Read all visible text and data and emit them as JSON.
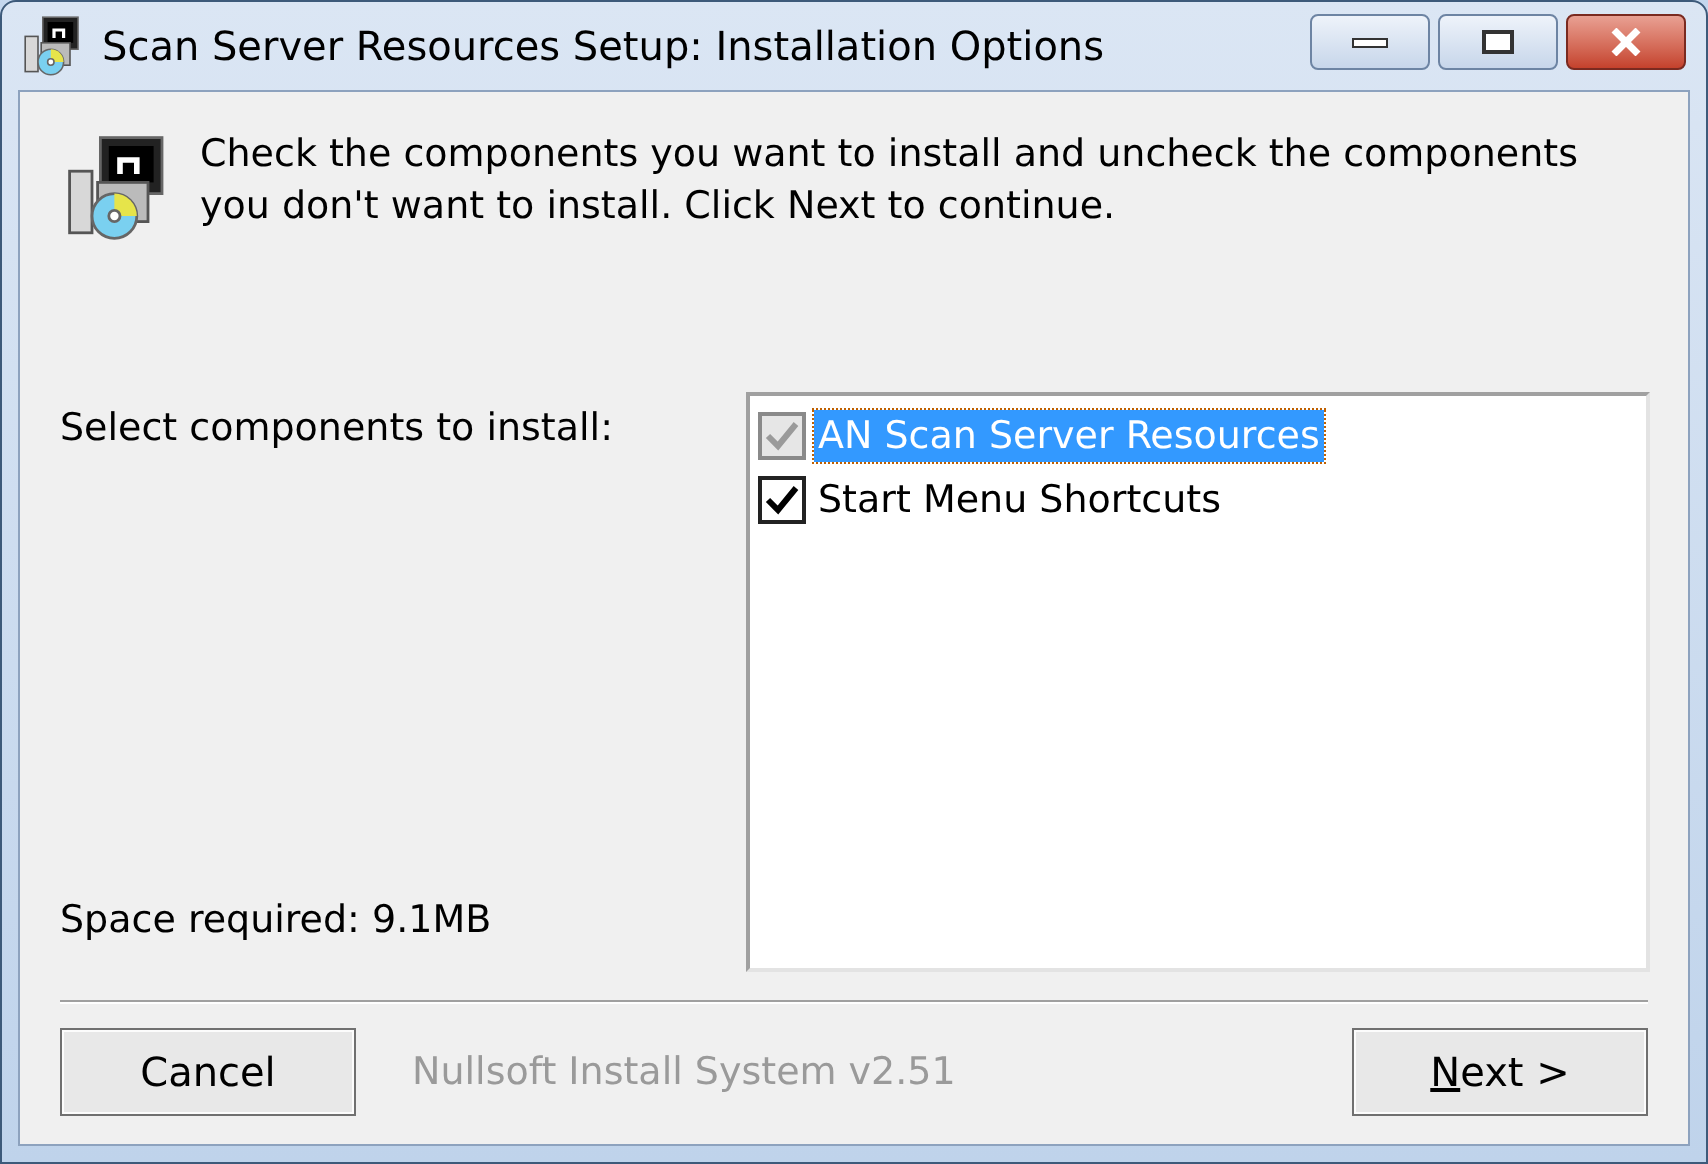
{
  "window": {
    "title": "Scan Server Resources Setup: Installation Options"
  },
  "header": {
    "text": "Check the components you want to install and uncheck the components you don't want to install. Click Next to continue."
  },
  "select_label": "Select components to install:",
  "space_required": "Space required: 9.1MB",
  "components": [
    {
      "label": "AN Scan Server Resources",
      "checked": true,
      "disabled": true,
      "selected": true
    },
    {
      "label": "Start Menu Shortcuts",
      "checked": true,
      "disabled": false,
      "selected": false
    }
  ],
  "branding": "Nullsoft Install System v2.51",
  "buttons": [
    {
      "label": "Cancel",
      "mnemonic": false
    },
    {
      "label": "Next >",
      "mnemonic": true
    }
  ]
}
